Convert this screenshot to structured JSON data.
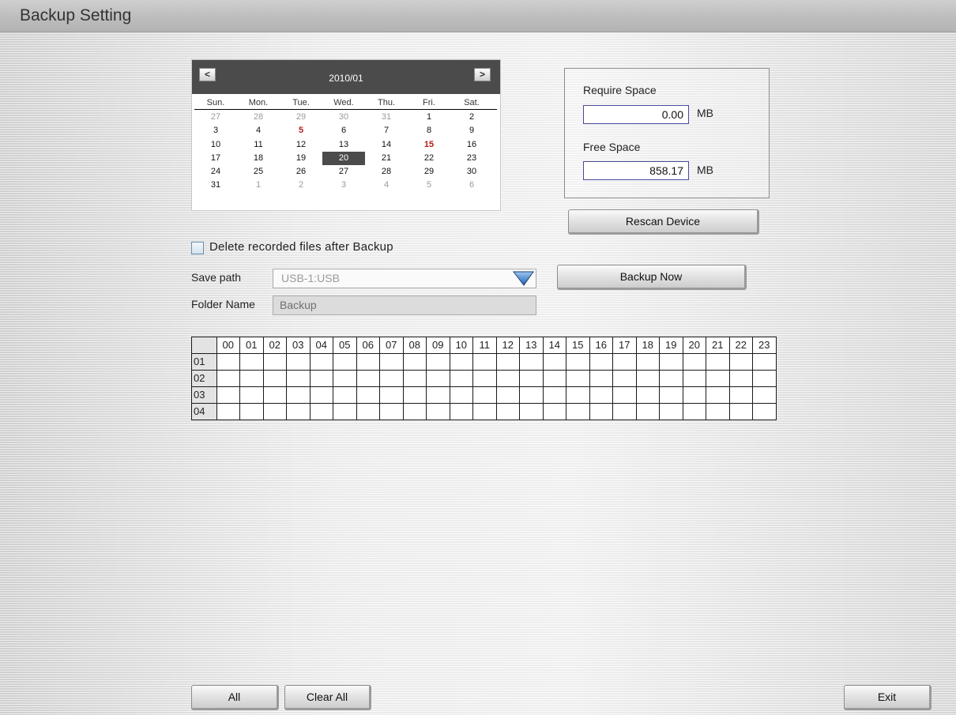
{
  "window": {
    "title": "Backup Setting"
  },
  "calendar": {
    "month": "2010/01",
    "prev_icon": "chevron-left-icon",
    "next_icon": "chevron-right-icon",
    "prev_glyph": "<",
    "next_glyph": ">",
    "day_names": [
      "Sun.",
      "Mon.",
      "Tue.",
      "Wed.",
      "Thu.",
      "Fri.",
      "Sat."
    ],
    "weeks": [
      [
        {
          "d": "27",
          "other": true
        },
        {
          "d": "28",
          "other": true
        },
        {
          "d": "29",
          "other": true
        },
        {
          "d": "30",
          "other": true
        },
        {
          "d": "31",
          "other": true
        },
        {
          "d": "1"
        },
        {
          "d": "2"
        }
      ],
      [
        {
          "d": "3"
        },
        {
          "d": "4"
        },
        {
          "d": "5",
          "marked": true
        },
        {
          "d": "6"
        },
        {
          "d": "7"
        },
        {
          "d": "8"
        },
        {
          "d": "9"
        }
      ],
      [
        {
          "d": "10"
        },
        {
          "d": "11"
        },
        {
          "d": "12"
        },
        {
          "d": "13"
        },
        {
          "d": "14"
        },
        {
          "d": "15",
          "marked": true
        },
        {
          "d": "16"
        }
      ],
      [
        {
          "d": "17"
        },
        {
          "d": "18"
        },
        {
          "d": "19"
        },
        {
          "d": "20",
          "selected": true
        },
        {
          "d": "21"
        },
        {
          "d": "22"
        },
        {
          "d": "23"
        }
      ],
      [
        {
          "d": "24"
        },
        {
          "d": "25"
        },
        {
          "d": "26"
        },
        {
          "d": "27"
        },
        {
          "d": "28"
        },
        {
          "d": "29"
        },
        {
          "d": "30"
        }
      ],
      [
        {
          "d": "31"
        },
        {
          "d": "1",
          "other": true
        },
        {
          "d": "2",
          "other": true
        },
        {
          "d": "3",
          "other": true
        },
        {
          "d": "4",
          "other": true
        },
        {
          "d": "5",
          "other": true
        },
        {
          "d": "6",
          "other": true
        }
      ]
    ],
    "colors": {
      "header": "#4b4b4b",
      "marked": "#b71c1c",
      "selected": "#4b4b4b",
      "other_month": "#9a9a9a"
    }
  },
  "space": {
    "require_label": "Require Space",
    "require_value": "0.00",
    "free_label": "Free Space",
    "free_value": "858.17",
    "unit": "MB"
  },
  "buttons": {
    "rescan": "Rescan Device",
    "backup_now": "Backup Now",
    "all": "All",
    "clear_all": "Clear All",
    "exit": "Exit"
  },
  "form": {
    "delete_after_backup_label": "Delete recorded files after Backup",
    "delete_after_backup_checked": false,
    "save_path_label": "Save path",
    "save_path_value": "USB-1:USB",
    "save_path_icon": "dropdown-arrow-icon",
    "folder_name_label": "Folder Name",
    "folder_name_value": "Backup"
  },
  "schedule": {
    "hours": [
      "00",
      "01",
      "02",
      "03",
      "04",
      "05",
      "06",
      "07",
      "08",
      "09",
      "10",
      "11",
      "12",
      "13",
      "14",
      "15",
      "16",
      "17",
      "18",
      "19",
      "20",
      "21",
      "22",
      "23"
    ],
    "rows": [
      "01",
      "02",
      "03",
      "04"
    ]
  }
}
